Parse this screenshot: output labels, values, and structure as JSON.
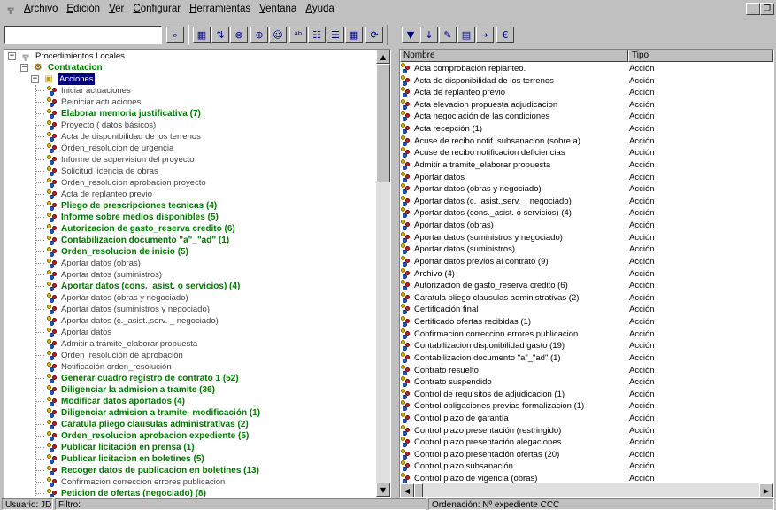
{
  "menu": {
    "items": [
      "Archivo",
      "Edición",
      "Ver",
      "Configurar",
      "Herramientas",
      "Ventana",
      "Ayuda"
    ]
  },
  "window_controls": {
    "minimize": "_",
    "restore": "❐"
  },
  "toolbar": {
    "search_value": "",
    "icons": [
      "find-icon",
      "table-icon",
      "sort-icon",
      "binoculars-icon",
      "zoom-icon",
      "people-icon",
      "abc-icon",
      "outline-icon",
      "list-view-icon",
      "grid-view-icon",
      "refresh-icon",
      "filter-icon",
      "sort-az-icon",
      "edit-icon",
      "report-icon",
      "export-icon",
      "help-icon"
    ]
  },
  "tree": {
    "root": "Procedimientos Locales",
    "group": "Contratacion",
    "folder": "Acciones",
    "items": [
      {
        "label": "Iniciar actuaciones",
        "bold": false
      },
      {
        "label": "Reiniciar actuaciones",
        "bold": false
      },
      {
        "label": "Elaborar memoria  justificativa (7)",
        "bold": true
      },
      {
        "label": "Proyecto ( datos básicos)",
        "bold": false
      },
      {
        "label": "Acta de disponibilidad de los terrenos",
        "bold": false
      },
      {
        "label": "Orden_resolucion de urgencia",
        "bold": false
      },
      {
        "label": "Informe de supervision del proyecto",
        "bold": false
      },
      {
        "label": "Solicitud licencia de obras",
        "bold": false
      },
      {
        "label": "Orden_resolucion aprobacion proyecto",
        "bold": false
      },
      {
        "label": "Acta de replanteo  previo",
        "bold": false
      },
      {
        "label": "Pliego de prescripciones tecnicas (4)",
        "bold": true
      },
      {
        "label": "Informe sobre medios disponibles (5)",
        "bold": true
      },
      {
        "label": "Autorizacion de gasto_reserva credito (6)",
        "bold": true
      },
      {
        "label": "Contabilizacion documento \"a\"_\"ad\" (1)",
        "bold": true
      },
      {
        "label": "Orden_resolucion de inicio (5)",
        "bold": true
      },
      {
        "label": "Aportar datos (obras)",
        "bold": false
      },
      {
        "label": "Aportar datos (suministros)",
        "bold": false
      },
      {
        "label": "Aportar datos (cons._asist. o servicios) (4)",
        "bold": true
      },
      {
        "label": "Aportar datos  (obras y negociado)",
        "bold": false
      },
      {
        "label": "Aportar datos (suministros y negociado)",
        "bold": false
      },
      {
        "label": "Aportar datos (c._asist.,serv. _ negociado)",
        "bold": false
      },
      {
        "label": "Aportar datos",
        "bold": false
      },
      {
        "label": "Admitir a trámite_elaborar propuesta",
        "bold": false
      },
      {
        "label": "Orden_resolución de aprobación",
        "bold": false
      },
      {
        "label": "Notificación orden_resolución",
        "bold": false
      },
      {
        "label": "Generar cuadro registro de contrato 1 (52)",
        "bold": true
      },
      {
        "label": "Diligenciar la admision a tramite (36)",
        "bold": true
      },
      {
        "label": "Modificar datos aportados (4)",
        "bold": true
      },
      {
        "label": "Diligenciar admision a tramite- modificación (1)",
        "bold": true
      },
      {
        "label": "Caratula pliego clausulas administrativas (2)",
        "bold": true
      },
      {
        "label": "Orden_resolucion aprobacion expediente (5)",
        "bold": true
      },
      {
        "label": "Publicar licitación en prensa (1)",
        "bold": true
      },
      {
        "label": "Publicar licitacion en boletines (5)",
        "bold": true
      },
      {
        "label": "Recoger datos de publicacion en boletines (13)",
        "bold": true
      },
      {
        "label": "Confirmacion correccion errores publicacion",
        "bold": false
      },
      {
        "label": "Peticion de ofertas (negociado) (8)",
        "bold": true
      }
    ]
  },
  "list": {
    "headers": {
      "name": "Nombre",
      "type": "Tipo"
    },
    "rows": [
      {
        "name": "Acta comprobación replanteo.",
        "type": "Acción"
      },
      {
        "name": "Acta de disponibilidad de los terrenos",
        "type": "Acción"
      },
      {
        "name": "Acta de replanteo  previo",
        "type": "Acción"
      },
      {
        "name": "Acta elevacion propuesta adjudicacion",
        "type": "Acción"
      },
      {
        "name": "Acta negociación de las condiciones",
        "type": "Acción"
      },
      {
        "name": "Acta recepción (1)",
        "type": "Acción"
      },
      {
        "name": "Acuse de recibo notif. subsanacion (sobre a)",
        "type": "Acción"
      },
      {
        "name": "Acuse de recibo notificacion deficiencias",
        "type": "Acción"
      },
      {
        "name": "Admitir a trámite_elaborar propuesta",
        "type": "Acción"
      },
      {
        "name": "Aportar datos",
        "type": "Acción"
      },
      {
        "name": "Aportar datos  (obras y negociado)",
        "type": "Acción"
      },
      {
        "name": "Aportar datos (c._asist.,serv. _ negociado)",
        "type": "Acción"
      },
      {
        "name": "Aportar datos (cons._asist. o servicios) (4)",
        "type": "Acción"
      },
      {
        "name": "Aportar datos (obras)",
        "type": "Acción"
      },
      {
        "name": "Aportar datos (suministros y negociado)",
        "type": "Acción"
      },
      {
        "name": "Aportar datos (suministros)",
        "type": "Acción"
      },
      {
        "name": "Aportar datos previos al contrato (9)",
        "type": "Acción"
      },
      {
        "name": "Archivo (4)",
        "type": "Acción"
      },
      {
        "name": "Autorizacion de gasto_reserva credito (6)",
        "type": "Acción"
      },
      {
        "name": "Caratula pliego clausulas administrativas (2)",
        "type": "Acción"
      },
      {
        "name": "Certificación final",
        "type": "Acción"
      },
      {
        "name": "Certificado ofertas recibidas (1)",
        "type": "Acción"
      },
      {
        "name": "Confirmacion correccion errores publicacion",
        "type": "Acción"
      },
      {
        "name": "Contabilizacion disponibilidad gasto (19)",
        "type": "Acción"
      },
      {
        "name": "Contabilizacion documento \"a\"_\"ad\" (1)",
        "type": "Acción"
      },
      {
        "name": "Contrato resuelto",
        "type": "Acción"
      },
      {
        "name": "Contrato suspendido",
        "type": "Acción"
      },
      {
        "name": "Control de requisitos de adjudicacion (1)",
        "type": "Acción"
      },
      {
        "name": "Control obligaciones previas formalizacion (1)",
        "type": "Acción"
      },
      {
        "name": "Control plazo de garantía",
        "type": "Acción"
      },
      {
        "name": "Control plazo presentación (restringido)",
        "type": "Acción"
      },
      {
        "name": "Control plazo presentación alegaciones",
        "type": "Acción"
      },
      {
        "name": "Control plazo presentación ofertas (20)",
        "type": "Acción"
      },
      {
        "name": "Control plazo subsanación",
        "type": "Acción"
      },
      {
        "name": "Control plazo de vigencia (obras)",
        "type": "Acción"
      }
    ]
  },
  "status": {
    "user": "Usuario: JDM",
    "filter": "Filtro:",
    "order": "Ordenación: Nº expediente CCC"
  }
}
